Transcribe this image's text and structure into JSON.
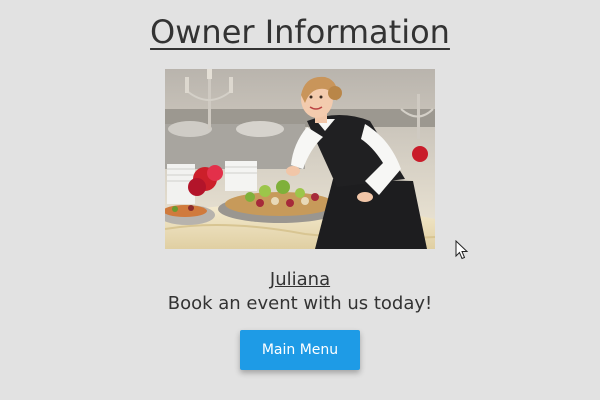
{
  "page": {
    "title": "Owner Information"
  },
  "owner": {
    "name": "Juliana",
    "tagline": "Book an event with us today!"
  },
  "actions": {
    "main_menu_label": "Main Menu"
  },
  "colors": {
    "background": "#e2e2e2",
    "text": "#333333",
    "button": "#1e9be6",
    "button_text": "#ffffff"
  },
  "icons": {
    "cursor": "mouse-pointer-icon"
  }
}
